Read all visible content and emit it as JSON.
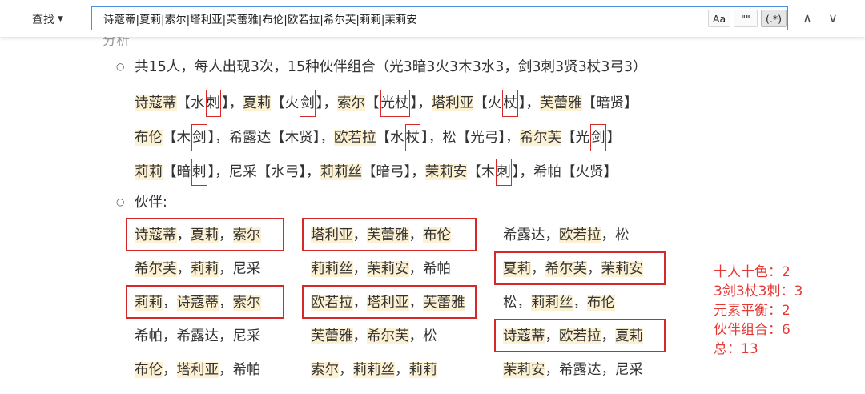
{
  "findbar": {
    "label": "查找",
    "query": "诗蔻蒂|夏莉|索尔|塔利亚|芙蕾雅|布伦|欧若拉|希尔芙|莉莉|茉莉安",
    "opt_case": "Aa",
    "opt_word": "\"\"",
    "opt_regex": "(.*)",
    "prev": "∧",
    "next": "∨"
  },
  "doc": {
    "partial_heading": "分析",
    "bullet1": "共15人，每人出现3次，15种伙伴组合（光3暗3火3木3水3，剑3刺3贤3杖3弓3）",
    "chars": [
      [
        {
          "name": "诗蔻蒂",
          "hl": true,
          "pre": "【水",
          "box": "刺",
          "post": "】"
        },
        {
          "name": "夏莉",
          "hl": true,
          "pre": "【火",
          "box": "剑",
          "post": "】"
        },
        {
          "name": "索尔",
          "hl": true,
          "pre": "【",
          "box": "光杖",
          "post": "】"
        },
        {
          "name": "塔利亚",
          "hl": true,
          "pre": "【火",
          "box": "杖",
          "post": "】"
        },
        {
          "name": "芙蕾雅",
          "hl": true,
          "pre": "【暗贤】",
          "box": "",
          "post": ""
        }
      ],
      [
        {
          "name": "布伦",
          "hl": true,
          "pre": "【木",
          "box": "剑",
          "post": "】"
        },
        {
          "name": "希露达",
          "hl": false,
          "pre": "【木贤】",
          "box": "",
          "post": ""
        },
        {
          "name": "欧若拉",
          "hl": true,
          "pre": "【水",
          "box": "杖",
          "post": "】"
        },
        {
          "name": "松",
          "hl": false,
          "pre": "【光弓】",
          "box": "",
          "post": ""
        },
        {
          "name": "希尔芙",
          "hl": true,
          "pre": "【光",
          "box": "剑",
          "post": "】"
        }
      ],
      [
        {
          "name": "莉莉",
          "hl": true,
          "pre": "【暗",
          "box": "刺",
          "post": "】"
        },
        {
          "name": "尼采",
          "hl": false,
          "pre": "【水弓】",
          "box": "",
          "post": ""
        },
        {
          "name": "莉莉丝",
          "hl": true,
          "pre": "【暗弓】",
          "box": "",
          "post": ""
        },
        {
          "name": "茉莉安",
          "hl": true,
          "pre": "【木",
          "box": "刺",
          "post": "】"
        },
        {
          "name": "希帕",
          "hl": false,
          "pre": "【火贤】",
          "box": "",
          "post": ""
        }
      ]
    ],
    "sep": "，",
    "bullet2": "伙伴:",
    "partners": [
      [
        [
          "诗蔻蒂",
          "夏莉",
          "索尔"
        ],
        [
          "塔利亚",
          "芙蕾雅",
          "布伦"
        ],
        [
          "希露达",
          "欧若拉",
          "松"
        ]
      ],
      [
        [
          "希尔芙",
          "莉莉",
          "尼采"
        ],
        [
          "莉莉丝",
          "茉莉安",
          "希帕"
        ],
        [
          "夏莉",
          "希尔芙",
          "茉莉安"
        ]
      ],
      [
        [
          "莉莉",
          "诗蔻蒂",
          "索尔"
        ],
        [
          "欧若拉",
          "塔利亚",
          "芙蕾雅"
        ],
        [
          "松",
          "莉莉丝",
          "布伦"
        ]
      ],
      [
        [
          "希帕",
          "希露达",
          "尼采"
        ],
        [
          "芙蕾雅",
          "希尔芙",
          "松"
        ],
        [
          "诗蔻蒂",
          "欧若拉",
          "夏莉"
        ]
      ],
      [
        [
          "布伦",
          "塔利亚",
          "希帕"
        ],
        [
          "索尔",
          "莉莉丝",
          "莉莉"
        ],
        [
          "茉莉安",
          "希露达",
          "尼采"
        ]
      ]
    ],
    "highlight_names": [
      "诗蔻蒂",
      "夏莉",
      "索尔",
      "塔利亚",
      "芙蕾雅",
      "布伦",
      "欧若拉",
      "希尔芙",
      "莉莉",
      "茉莉安",
      "莉莉丝"
    ],
    "boxed_groups": [
      [
        0,
        0
      ],
      [
        0,
        1
      ],
      [
        1,
        2
      ],
      [
        2,
        0
      ],
      [
        2,
        1
      ],
      [
        3,
        2
      ]
    ],
    "tally": [
      "十人十色：2",
      "3剑3杖3刺：3",
      "元素平衡：2",
      "伙伴组合：6",
      "总：13"
    ]
  }
}
